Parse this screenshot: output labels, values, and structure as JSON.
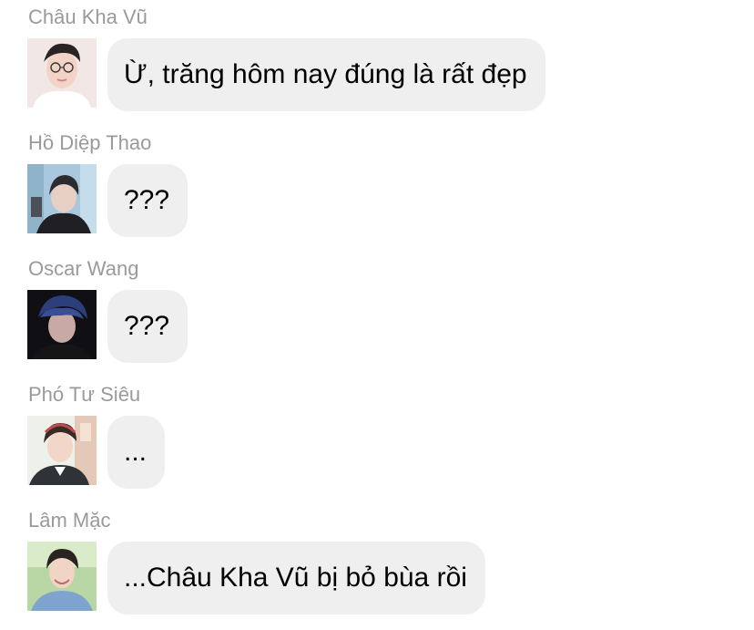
{
  "messages": [
    {
      "sender": "Châu Kha Vũ",
      "text": "Ừ, trăng hôm nay đúng là rất đẹp",
      "avatar_icon": "avatar-chau-kha-vu"
    },
    {
      "sender": "Hồ Diệp Thao",
      "text": "???",
      "avatar_icon": "avatar-ho-diep-thao"
    },
    {
      "sender": "Oscar Wang",
      "text": "???",
      "avatar_icon": "avatar-oscar-wang"
    },
    {
      "sender": "Phó Tư Siêu",
      "text": "...",
      "avatar_icon": "avatar-pho-tu-sieu"
    },
    {
      "sender": "Lâm Mặc",
      "text": "...Châu Kha Vũ bị bỏ bùa rồi",
      "avatar_icon": "avatar-lam-mac"
    }
  ],
  "colors": {
    "bubble": "#efefef",
    "sender_name": "#9a9a9a",
    "background": "#ffffff"
  }
}
